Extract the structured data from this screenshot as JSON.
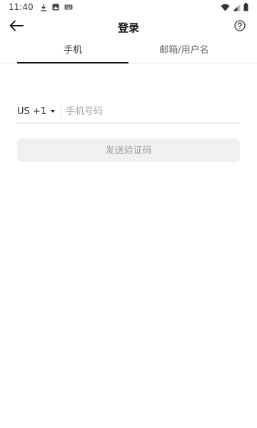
{
  "status_bar": {
    "time": "11:40",
    "left_icons": [
      "download-icon",
      "photo-icon",
      "keyboard-icon"
    ],
    "right_icons": [
      "wifi-icon",
      "signal-icon",
      "battery-icon"
    ]
  },
  "header": {
    "title": "登录",
    "back_icon": "arrow-left-icon",
    "help_icon": "help-circle-icon"
  },
  "tabs": [
    {
      "label": "手机",
      "active": true
    },
    {
      "label": "邮箱/用户名",
      "active": false
    }
  ],
  "phone": {
    "country_code": "US +1",
    "placeholder": "手机号码",
    "value": ""
  },
  "send_button": {
    "label": "发送验证码",
    "enabled": false
  },
  "colors": {
    "active_tab_indicator": "#111111",
    "button_bg_disabled": "#f1f1f1",
    "button_text_disabled": "#9e9e9e",
    "placeholder": "#a8a8a8"
  }
}
